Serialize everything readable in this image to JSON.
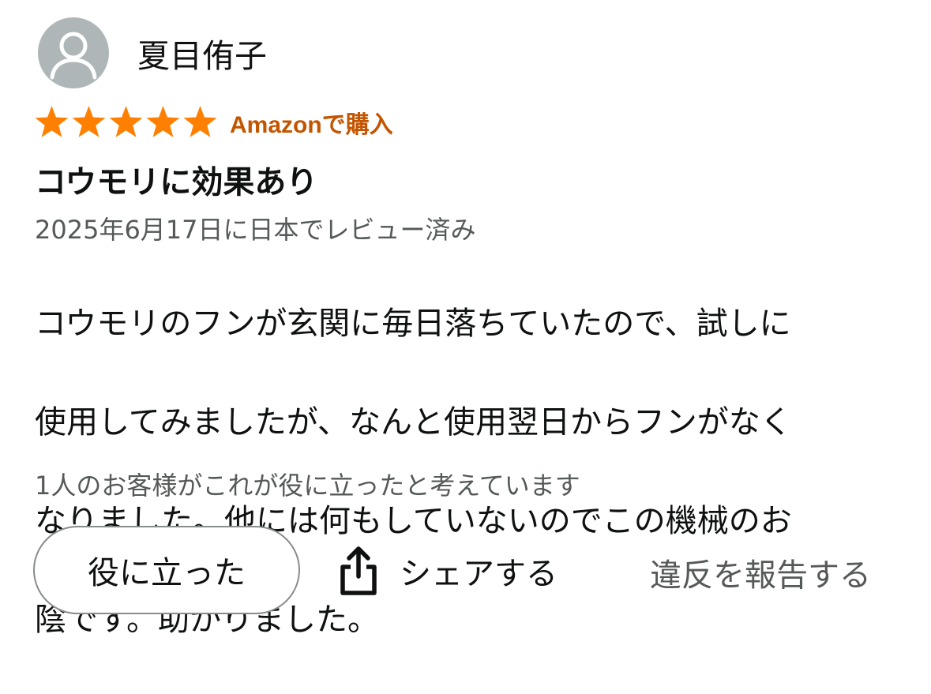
{
  "review": {
    "author": {
      "name": "夏目侑子",
      "avatar_icon": "user-silhouette-icon"
    },
    "rating": {
      "stars": 5,
      "max": 5,
      "star_icon": "star-icon",
      "star_color": "#ff8000"
    },
    "verified_purchase": "Amazonで購入",
    "verified_color": "#c45500",
    "title": "コウモリに効果あり",
    "date": "2025年6月17日に日本でレビュー済み",
    "body_lines": [
      "コウモリのフンが玄関に毎日落ちていたので、試しに",
      "使用してみましたが、なんと使用翌日からフンがなく",
      "なりました。他には何もしていないのでこの機械のお",
      "陰です。助かりました。"
    ],
    "helpful_count_text": "1人のお客様がこれが役に立ったと考えています"
  },
  "actions": {
    "helpful_label": "役に立った",
    "share_label": "シェアする",
    "share_icon": "share-icon",
    "report_label": "違反を報告する"
  }
}
